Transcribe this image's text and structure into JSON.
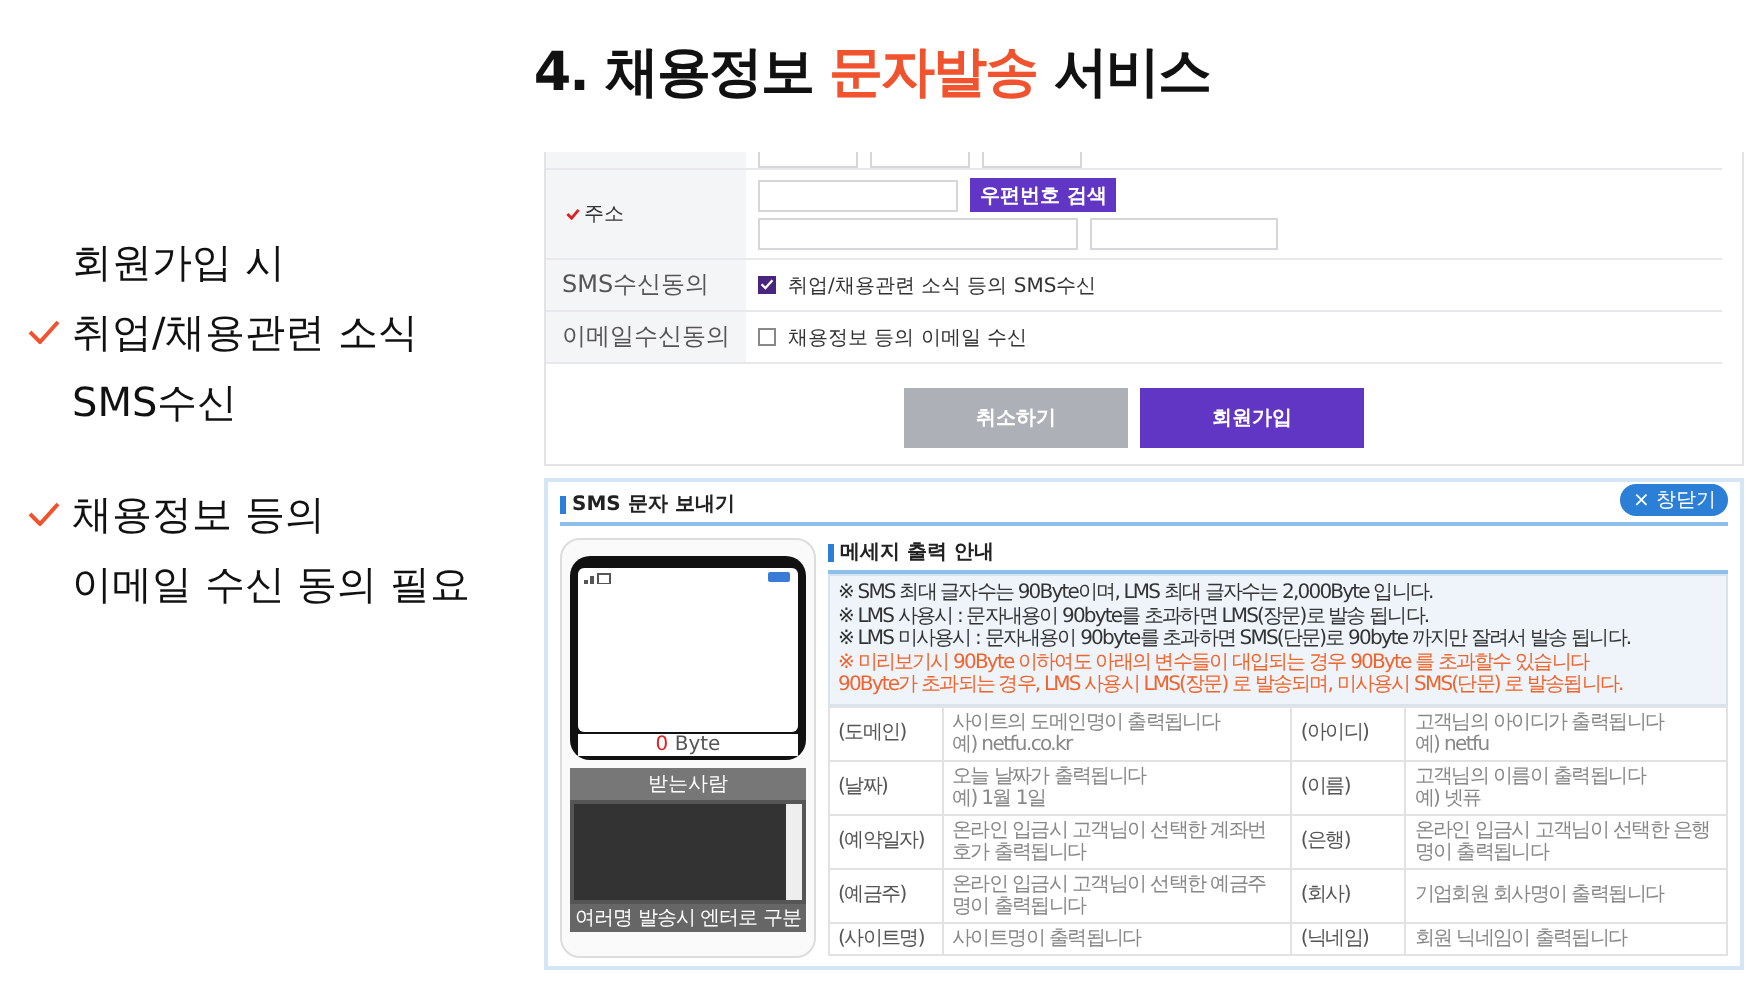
{
  "slide": {
    "title_parts": [
      {
        "text": "4. 채용정보 ",
        "kind": "plain"
      },
      {
        "text": "문자발송",
        "kind": "accent"
      },
      {
        "text": " 서비스",
        "kind": "plain"
      }
    ]
  },
  "points": [
    {
      "lines": [
        {
          "text": "회원가입 시",
          "checkmark": false
        },
        {
          "text": "취업/채용관련 소식",
          "checkmark": true
        },
        {
          "text": "SMS수신",
          "checkmark": false
        }
      ]
    },
    {
      "lines": [
        {
          "text": "채용정보 등의",
          "checkmark": true
        },
        {
          "text": "이메일 수신 동의 필요",
          "checkmark": false
        }
      ]
    }
  ],
  "signup_form": {
    "address": {
      "label": "주소",
      "required": true,
      "search_button": "우편번호 검색"
    },
    "consents": [
      {
        "label": "SMS수신동의",
        "option": "취업/채용관련 소식 등의 SMS수신",
        "checked": true
      },
      {
        "label": "이메일수신동의",
        "option": "채용정보 등의 이메일 수신",
        "checked": false
      }
    ],
    "buttons": [
      {
        "label": "취소하기",
        "kind": "secondary"
      },
      {
        "label": "회원가입",
        "kind": "primary"
      }
    ]
  },
  "sms_sender": {
    "title": "SMS 문자 보내기",
    "close_button": "× 창닫기",
    "phone": {
      "byte_count": "0",
      "byte_unit": "Byte",
      "recipients_header": "받는사람",
      "recipients_hint": "여러명 발송시 엔터로 구분"
    },
    "guide": {
      "title": "메세지 출력 안내",
      "notes": [
        {
          "text": "※ SMS 최대 글자수는 90Byte이며, LMS 최대 글자수는 2,000Byte 입니다.",
          "kind": "info"
        },
        {
          "text": "※ LMS 사용시 : 문자내용이 90byte를 초과하면 LMS(장문)로 발송 됩니다.",
          "kind": "info"
        },
        {
          "text": "※ LMS 미사용시 : 문자내용이 90byte를 초과하면 SMS(단문)로 90byte 까지만 잘려서 발송 됩니다.",
          "kind": "info"
        },
        {
          "text": "※ 미리보기시 90Byte 이하여도 아래의 변수들이 대입되는 경우 90Byte 를 초과할수 있습니다",
          "kind": "warning"
        },
        {
          "text": "90Byte가 초과되는 경우, LMS 사용시 LMS(장문) 로 발송되며, 미사용시 SMS(단문) 로 발송됩니다.",
          "kind": "warning"
        }
      ],
      "variable_rows": [
        {
          "cells": [
            {
              "name": "(도메인)",
              "description": "사이트의 도메인명이 출력됩니다",
              "example": "예) netfu.co.kr"
            },
            {
              "name": "(아이디)",
              "description": "고객님의 아이디가 출력됩니다",
              "example": "예) netfu"
            }
          ]
        },
        {
          "cells": [
            {
              "name": "(날짜)",
              "description": "오늘 날짜가 출력됩니다",
              "example": "예) 1월 1일"
            },
            {
              "name": "(이름)",
              "description": "고객님의 이름이 출력됩니다",
              "example": "예) 넷퓨"
            }
          ]
        },
        {
          "cells": [
            {
              "name": "(예약일자)",
              "description": "온라인 입금시 고객님이 선택한 계좌번호가 출력됩니다"
            },
            {
              "name": "(은행)",
              "description": "온라인 입금시 고객님이 선택한 은행명이 출력됩니다"
            }
          ]
        },
        {
          "cells": [
            {
              "name": "(예금주)",
              "description": "온라인 입금시 고객님이 선택한 예금주명이 출력됩니다"
            },
            {
              "name": "(회사)",
              "description": "기업회원 회사명이 출력됩니다"
            }
          ]
        },
        {
          "cells": [
            {
              "name": "(사이트명)",
              "description": "사이트명이 출력됩니다"
            },
            {
              "name": "(닉네임)",
              "description": "회원 닉네임이 출력됩니다"
            }
          ]
        }
      ]
    }
  }
}
